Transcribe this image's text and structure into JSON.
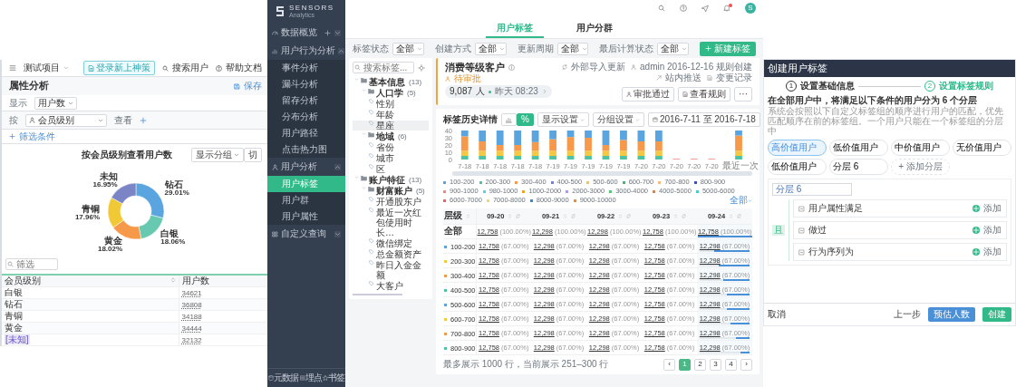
{
  "attribute_window": {
    "topbar": {
      "project": "测试项目",
      "upgrade_button": "登录新上神策",
      "search_user": "搜索用户",
      "help": "帮助文档"
    },
    "title": "属性分析",
    "save": "保存",
    "display_label": "显示",
    "display_select": "用户数",
    "by_label": "按",
    "by_select": "会员级别",
    "view_label": "查看",
    "filter_link": "筛选条件",
    "chart": {
      "group_button": "显示分组",
      "cut_button": "切",
      "chart_data": {
        "type": "donut",
        "title": "按会员级别查看用户数",
        "categories": [
          "钻石",
          "白银",
          "黄金",
          "青铜",
          "未知"
        ],
        "values": [
          29.01,
          18.06,
          18.02,
          17.96,
          16.95
        ],
        "value_labels": [
          "29.01%",
          "18.06%",
          "18.02%",
          "17.96%",
          "16.95%"
        ]
      }
    },
    "table_filter": {
      "placeholder": "筛选"
    },
    "table": {
      "columns": [
        "会员级别",
        "用户数"
      ],
      "rows": [
        {
          "cells": [
            "白银",
            "34621"
          ],
          "tagged": false
        },
        {
          "cells": [
            "钻石",
            "36808"
          ],
          "tagged": false
        },
        {
          "cells": [
            "青铜",
            "34188"
          ],
          "tagged": false
        },
        {
          "cells": [
            "黄金",
            "34444"
          ],
          "tagged": false
        },
        {
          "cells": [
            "[未知]",
            "32132"
          ],
          "tagged": true
        }
      ]
    }
  },
  "sidebar": {
    "logo": {
      "name": "SENSORS",
      "sub": "Analytics"
    },
    "sections": [
      {
        "label": "数据概览",
        "expanded": false,
        "addable": true
      },
      {
        "label": "用户行为分析",
        "expanded": true,
        "addable": false,
        "children": [
          {
            "label": "事件分析",
            "selected": false
          },
          {
            "label": "漏斗分析",
            "selected": false
          },
          {
            "label": "留存分析",
            "selected": false
          },
          {
            "label": "分布分析",
            "selected": false
          },
          {
            "label": "用户路径",
            "selected": false
          },
          {
            "label": "点击热力图",
            "selected": false
          }
        ]
      },
      {
        "label": "用户分析",
        "expanded": true,
        "addable": false,
        "children": [
          {
            "label": "用户标签",
            "selected": true
          },
          {
            "label": "用户群",
            "selected": false
          },
          {
            "label": "用户属性",
            "selected": false
          }
        ]
      },
      {
        "label": "自定义查询",
        "expanded": false,
        "addable": false
      }
    ],
    "footer": [
      "元数据",
      "埋点",
      "书签"
    ]
  },
  "main": {
    "topbar": {
      "avatar": "S",
      "notification": true
    },
    "tabs": [
      {
        "label": "用户标签",
        "selected": true
      },
      {
        "label": "用户分群",
        "selected": false
      }
    ],
    "filters": [
      {
        "label": "标签状态",
        "value": "全部"
      },
      {
        "label": "创建方式",
        "value": "全部"
      },
      {
        "label": "更新周期",
        "value": "全部"
      },
      {
        "label": "最后计算状态",
        "value": "全部"
      }
    ],
    "new_button": "新建标签",
    "tree": {
      "search_placeholder": "搜索标签...",
      "nodes": [
        {
          "label": "基本信息",
          "count": "(13)",
          "children": [
            {
              "label": "人口学",
              "count": "(5)",
              "children": [
                {
                  "label": "性别",
                  "selected": false
                },
                {
                  "label": "年龄",
                  "selected": false
                },
                {
                  "label": "星座",
                  "selected": true
                }
              ]
            },
            {
              "label": "地域",
              "count": "(6)",
              "children": [
                {
                  "label": "省份",
                  "selected": false
                },
                {
                  "label": "城市",
                  "selected": false
                },
                {
                  "label": "区",
                  "selected": false
                }
              ]
            }
          ]
        },
        {
          "label": "账户特征",
          "count": "(13)",
          "children": [
            {
              "label": "财富账户",
              "count": "(5)",
              "children": [
                {
                  "label": "开通股东户",
                  "selected": false
                },
                {
                  "label": "最近一次红包使用时长…",
                  "selected": false
                },
                {
                  "label": "微信绑定",
                  "selected": false
                },
                {
                  "label": "总金额资产",
                  "selected": false
                },
                {
                  "label": "昨日入金金额",
                  "selected": false
                },
                {
                  "label": "大客户",
                  "selected": false
                }
              ]
            }
          ]
        }
      ]
    },
    "detail": {
      "title": "消费等级客户",
      "status": "待审批",
      "count": "9,087",
      "unit": "人",
      "update_time": "昨天 08:23",
      "meta": [
        "外部导入更新",
        "admin 2016-12-16 规则创建",
        "站内推送",
        "变更记录"
      ],
      "buttons": [
        "审批通过",
        "查看规则"
      ],
      "more": "···"
    },
    "history": {
      "title": "标签历史详情",
      "toggles": [
        {
          "kind": "chart",
          "selected": false
        },
        {
          "kind": "percent",
          "label": "%",
          "selected": true
        }
      ],
      "display_setting": "显示设置",
      "group_setting": "分组设置",
      "date_range": "2016-7-11 至 2016-7-18",
      "chart_data": {
        "type": "bar",
        "stacked": true,
        "categories": [
          "7-18",
          "7-18",
          "7-18",
          "7-18",
          "7-18",
          "7-19",
          "7-19",
          "7-19",
          "7-19",
          "7-19",
          "7-20",
          "7-20",
          "7-20",
          "7-20",
          "7-20",
          "最近一次"
        ],
        "ylim": [
          0,
          40
        ],
        "yticks": [
          0,
          10,
          20,
          30,
          40
        ],
        "series": [
          {
            "color": "#4fc3a1",
            "values": [
              5,
              5,
              5,
              5,
              5,
              5,
              5,
              5,
              5,
              5,
              5,
              5,
              null,
              null,
              null,
              5
            ]
          },
          {
            "color": "#f5c842",
            "values": [
              7,
              7,
              7,
              7,
              7,
              7,
              7,
              7,
              7,
              7,
              7,
              7,
              null,
              null,
              null,
              7
            ]
          },
          {
            "color": "#f7994a",
            "values": [
              20,
              13,
              8,
              8,
              12,
              16,
              19,
              18,
              8,
              15,
              13,
              13,
              null,
              null,
              null,
              21
            ]
          },
          {
            "color": "#5aa5e0",
            "values": [
              8,
              15,
              20,
              20,
              16,
              12,
              9,
              10,
              20,
              13,
              15,
              15,
              null,
              null,
              null,
              7
            ]
          },
          {
            "color": "#f08a7e",
            "values": [
              null,
              null,
              null,
              null,
              null,
              null,
              null,
              null,
              null,
              null,
              null,
              null,
              1,
              1,
              1,
              null
            ]
          }
        ]
      },
      "legend": [
        {
          "label": "100-200",
          "color": "#5aa5e0"
        },
        {
          "label": "200-300",
          "color": "#4fc3a1"
        },
        {
          "label": "300-400",
          "color": "#f7994a"
        },
        {
          "label": "400-500",
          "color": "#7b7fd1"
        },
        {
          "label": "500-600",
          "color": "#f5c842"
        },
        {
          "label": "600-700",
          "color": "#3cb878"
        },
        {
          "label": "700-800",
          "color": "#f8b97a"
        },
        {
          "label": "800-900",
          "color": "#3f51b5"
        },
        {
          "label": "900-1000",
          "color": "#f08a7e"
        },
        {
          "label": "980-1000",
          "color": "#5bd0e8"
        },
        {
          "label": "1000-2000",
          "color": "#f0a030"
        },
        {
          "label": "2000-3000",
          "color": "#a99be0"
        },
        {
          "label": "3000-4000",
          "color": "#59c47a"
        },
        {
          "label": "4000-5000",
          "color": "#c98a5e"
        },
        {
          "label": "5000-6000",
          "color": "#4fc9c9"
        },
        {
          "label": "6000-7000",
          "color": "#f06060"
        },
        {
          "label": "7000-8000",
          "color": "#f3d77a"
        },
        {
          "label": "8000-9000",
          "color": "#3d86d8"
        },
        {
          "label": "9000-10000",
          "color": "#f28a2e"
        }
      ],
      "legend_more": "全部",
      "table": {
        "columns": [
          "层级",
          "09-20",
          "09-21",
          "09-22",
          "09-23",
          "09-24"
        ],
        "rows": [
          {
            "level": 1.0,
            "cells": [
              {
                "text": "全部"
              },
              {
                "count": "12,758",
                "percent": "(100.00%)"
              },
              {
                "count": "12,298",
                "percent": "(100.00%)"
              },
              {
                "count": "12,298",
                "percent": "(100.00%)"
              },
              {
                "count": "12,758",
                "percent": "(100.00%)"
              },
              {
                "count": "12,758",
                "percent": "(100.00%)"
              }
            ]
          },
          {
            "color": "#5aa5e0",
            "level": 0.7,
            "cells": [
              {
                "text": "100-200"
              },
              {
                "count": "12,758",
                "percent": "(67.00%)"
              },
              {
                "count": "12,298",
                "percent": "(67.00%)"
              },
              {
                "count": "12,298",
                "percent": "(67.00%)"
              },
              {
                "count": "12,758",
                "percent": "(67.00%)"
              },
              {
                "count": "12,298",
                "percent": "(67.00%)"
              }
            ]
          },
          {
            "color": "#f5c842",
            "level": 0.62,
            "cells": [
              {
                "text": "200-300"
              },
              {
                "count": "12,758",
                "percent": "(67.00%)"
              },
              {
                "count": "12,298",
                "percent": "(67.00%)"
              },
              {
                "count": "12,298",
                "percent": "(67.00%)"
              },
              {
                "count": "12,758",
                "percent": "(67.00%)"
              },
              {
                "count": "12,298",
                "percent": "(67.00%)"
              }
            ]
          },
          {
            "color": "#f7994a",
            "level": 0.52,
            "cells": [
              {
                "text": "300-400"
              },
              {
                "count": "12,758",
                "percent": "(67.00%)"
              },
              {
                "count": "12,298",
                "percent": "(67.00%)"
              },
              {
                "count": "12,298",
                "percent": "(67.00%)"
              },
              {
                "count": "12,758",
                "percent": "(67.00%)"
              },
              {
                "count": "12,298",
                "percent": "(67.00%)"
              }
            ]
          },
          {
            "color": "#4fc3a1",
            "level": 0.45,
            "cells": [
              {
                "text": "400-500"
              },
              {
                "count": "12,758",
                "percent": "(67.00%)"
              },
              {
                "count": "12,298",
                "percent": "(67.00%)"
              },
              {
                "count": "12,298",
                "percent": "(67.00%)"
              },
              {
                "count": "12,758",
                "percent": "(67.00%)"
              },
              {
                "count": "12,298",
                "percent": "(67.00%)"
              }
            ]
          },
          {
            "color": "#5aa5e0",
            "level": 0.45,
            "cells": [
              {
                "text": "500-600"
              },
              {
                "count": "12,758",
                "percent": "(67.00%)"
              },
              {
                "count": "12,298",
                "percent": "(67.00%)"
              },
              {
                "count": "12,298",
                "percent": "(67.00%)"
              },
              {
                "count": "12,758",
                "percent": "(67.00%)"
              },
              {
                "count": "12,298",
                "percent": "(67.00%)"
              }
            ]
          },
          {
            "color": "#f5c842",
            "level": 0.38,
            "cells": [
              {
                "text": "600-700"
              },
              {
                "count": "12,758",
                "percent": "(67.00%)"
              },
              {
                "count": "12,298",
                "percent": "(67.00%)"
              },
              {
                "count": "12,298",
                "percent": "(67.00%)"
              },
              {
                "count": "12,758",
                "percent": "(67.00%)"
              },
              {
                "count": "12,298",
                "percent": "(67.00%)"
              }
            ]
          },
          {
            "color": "#f7994a",
            "level": 0.28,
            "cells": [
              {
                "text": "700-800"
              },
              {
                "count": "12,758",
                "percent": "(67.00%)"
              },
              {
                "count": "12,298",
                "percent": "(67.00%)"
              },
              {
                "count": "12,298",
                "percent": "(67.00%)"
              },
              {
                "count": "12,758",
                "percent": "(67.00%)"
              },
              {
                "count": "12,298",
                "percent": "(67.00%)"
              }
            ]
          },
          {
            "color": "#4fc3a1",
            "level": 0.18,
            "cells": [
              {
                "text": "800-900"
              },
              {
                "count": "12,758",
                "percent": "(67.00%)"
              },
              {
                "count": "12,298",
                "percent": "(67.00%)"
              },
              {
                "count": "12,298",
                "percent": "(67.00%)"
              },
              {
                "count": "12,758",
                "percent": "(67.00%)"
              },
              {
                "count": "12,298",
                "percent": "(67.00%)"
              }
            ]
          }
        ]
      },
      "footer_text": "最多展示 1000 行，当前展示 251–300 行",
      "prev": "‹",
      "next": "›",
      "pages": [
        {
          "label": "1",
          "selected": true
        },
        {
          "label": "2",
          "selected": false
        },
        {
          "label": "3",
          "selected": false
        },
        {
          "label": "4",
          "selected": false
        }
      ]
    }
  },
  "create_window": {
    "title": "创建用户标签",
    "steps": [
      {
        "number": "1",
        "label": "设置基础信息",
        "selected": false
      },
      {
        "number": "2",
        "label": "设置标签规则",
        "selected": true
      }
    ],
    "heading": "在全部用户中，将满足以下条件的用户分为 6 个分层",
    "description": "系统会按照以下自定义标签组的顺序进行用户的匹配，优先匹配顺序在前的标签组。一个用户只能在一个标签组的分层中",
    "chips": [
      {
        "label": "高价值用户",
        "selected": true
      },
      {
        "label": "低价值用户",
        "selected": false
      },
      {
        "label": "中价值用户",
        "selected": false
      },
      {
        "label": "无价值用户",
        "selected": false
      },
      {
        "label": "低价值用户",
        "selected": false
      },
      {
        "label": "分层 6",
        "selected": false
      }
    ],
    "add_chip": "+ 添加分层",
    "layer_name": "分层 6",
    "connector": "且",
    "conditions": [
      {
        "label": "用户属性满足",
        "add": "添加"
      },
      {
        "label": "做过",
        "add": "添加"
      },
      {
        "label": "行为序列为",
        "add": "添加"
      }
    ],
    "footer": {
      "cancel": "取消",
      "prev": "上一步",
      "estimate": "预估人数",
      "create": "创建"
    }
  }
}
